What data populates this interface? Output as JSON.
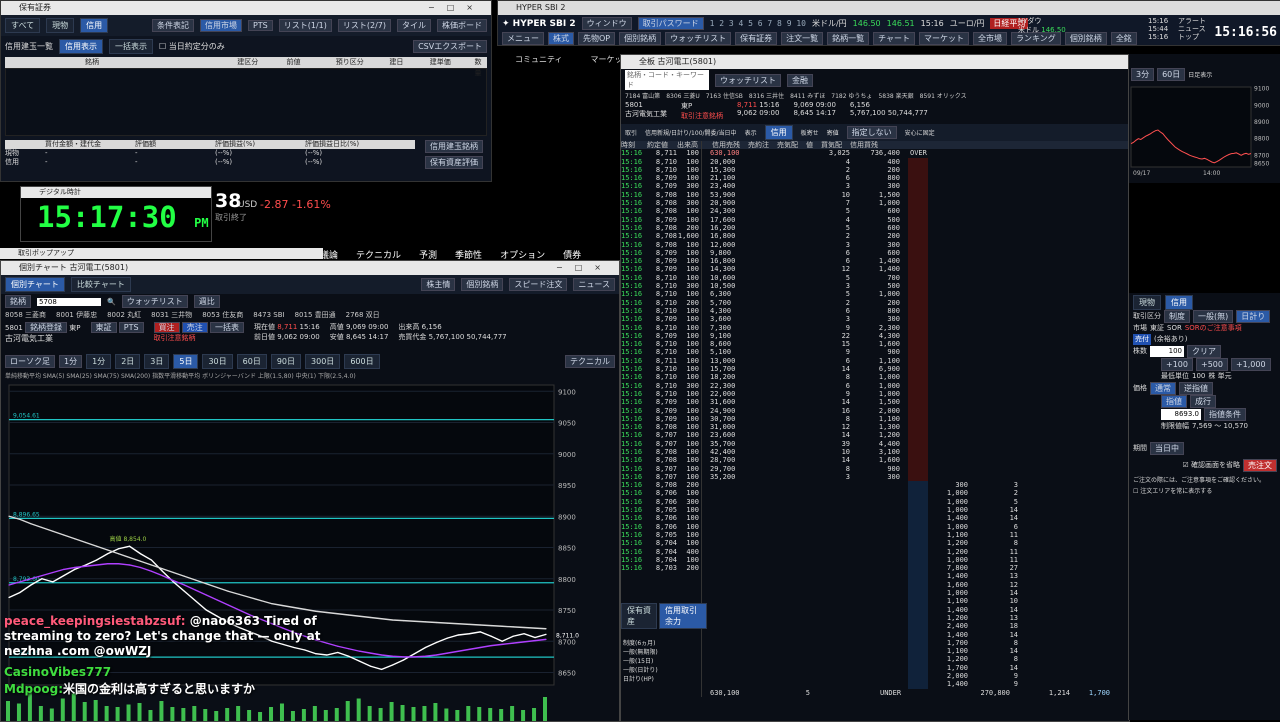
{
  "holdings_window": {
    "title": "保有証券",
    "tabs": [
      "すべて",
      "現物",
      "信用"
    ],
    "buttons": [
      "条件表記",
      "信用市場",
      "PTS",
      "リスト(1/1)",
      "リスト(2/7)",
      "タイル",
      "株価ボード"
    ],
    "subtabs": [
      "信用建玉一覧",
      "信用表示",
      "一括表示"
    ],
    "checkbox": "当日約定分のみ",
    "csv_button": "CSVエクスポート",
    "columns": [
      "銘柄",
      "建区分",
      "前値",
      "預り区分",
      "建日",
      "建単価",
      "数量"
    ],
    "summary_headers": [
      "買付金額・建代金",
      "評価額",
      "評価損益(%)",
      "評価損益日比(%)"
    ],
    "summary_rows": [
      {
        "label": "現物",
        "values": [
          "-",
          "-",
          "(--%)",
          "(--%)"
        ]
      },
      {
        "label": "信用",
        "values": [
          "-",
          "-",
          "(--%)",
          "(--%)"
        ]
      }
    ],
    "right_buttons": [
      "信用建玉銘柄",
      "保有資産評価"
    ]
  },
  "sbi_toolbar": {
    "title": "HYPER SBI 2",
    "menu": [
      "メニュー",
      "株式",
      "先物OP",
      "個別銘柄",
      "ウォッチリスト",
      "保有証券",
      "注文一覧",
      "銘柄一覧",
      "チャート",
      "マーケット",
      "全市場",
      "ランキング",
      "個別銘柄",
      "全銘"
    ],
    "window_label": "ウィンドウ",
    "order_password": "取引パスワード",
    "numbers": [
      "1",
      "2",
      "3",
      "4",
      "5",
      "6",
      "7",
      "8",
      "9",
      "10"
    ],
    "fx": [
      {
        "label": "米ドル/円",
        "value": "146.50",
        "change": "146.51"
      },
      {
        "label": "ユーロ/円",
        "value": ""
      }
    ],
    "time": "15:16",
    "indices": [
      {
        "name": "日経平均",
        "value": ""
      },
      {
        "name": "NYダウ",
        "value": ""
      },
      {
        "name": "米ドル",
        "value": "146.50"
      }
    ],
    "clock_small": [
      "15:16",
      "15:44",
      "15:16"
    ],
    "alerts": [
      "アラート",
      "ニュース",
      "トップ"
    ],
    "clock": "15:16:56"
  },
  "digital_clock": {
    "title": "デジタル時計",
    "time": "15:17:30",
    "ampm": "PM"
  },
  "background_ticker": {
    "value": "38",
    "currency": "USD",
    "change": "-2.87",
    "change_pct": "-1.61%",
    "sub": "取引終了"
  },
  "background_nav": [
    "議論",
    "テクニカル",
    "予測",
    "季節性",
    "オプション",
    "債券"
  ],
  "community_nav": [
    "コミュニティ",
    "マーケット"
  ],
  "popup_title": "取引ポップアップ",
  "chart_window": {
    "title": "個別チャート 古河電工(5801)",
    "tabs": [
      "個別チャート",
      "比較チャート"
    ],
    "right_tabs": [
      "株主情",
      "個別銘柄",
      "スピード注文",
      "ニュース"
    ],
    "search_label": "銘柄",
    "search_value": "5708",
    "dropdowns": [
      "ウォッチリスト",
      "週比"
    ],
    "stock_list": [
      "8058 三菱商",
      "8001 伊藤忠",
      "8002 丸紅",
      "8031 三井物",
      "8053 住友商",
      "8473 SBI",
      "8015 豊田通",
      "2768 双日"
    ],
    "code": "5801",
    "name": "古河電気工業",
    "market": "東P",
    "buttons": [
      "銘柄登録",
      "東証",
      "PTS",
      "買注",
      "売注",
      "一括表"
    ],
    "warn": "取引注意銘柄",
    "price_label": "現在値",
    "price": "8,711",
    "time": "15:16",
    "prev_label": "前日値",
    "prev": "9,062 09:00",
    "high_label": "高値",
    "high": "9,069 09:00",
    "low_label": "安値",
    "low": "8,645 14:17",
    "vol_label": "出来高",
    "volume": "6,156",
    "value_label": "売買代金",
    "value": "5,767,100",
    "other": "50,744,777",
    "chart_type": "ローソク足",
    "period": "1分",
    "period_buttons": [
      "1分",
      "2日",
      "3日",
      "5日",
      "30日",
      "60日",
      "90日",
      "300日",
      "600日"
    ],
    "legend": "単純移動平均 SMA(5) SMA(25) SMA(75) SMA(200) 指数平滑移動平均 ボリンジャーバンド 上限(1.5,80) 中央(1) 下限(2.5,4.0)",
    "tech_btn": "テクニカル"
  },
  "chart_data": {
    "type": "line",
    "title": "古河電気工業 5801 1分足",
    "xlabel": "",
    "ylabel": "",
    "x_ticks": [
      "09/17",
      "11:30",
      "13:00",
      "13:30",
      "14:00",
      "14:30",
      "15:00"
    ],
    "y_ticks": [
      "9100",
      "9050",
      "9000",
      "8950",
      "8900",
      "8850",
      "8800",
      "8750",
      "8700",
      "8650"
    ],
    "ylim": [
      8630,
      9110
    ],
    "hlines": [
      {
        "label": "9,054.61",
        "value": 9054.6
      },
      {
        "label": "8,896.65",
        "value": 8896.65
      },
      {
        "label": "8,793.60",
        "value": 8793.6
      },
      {
        "label": "8,674.65",
        "value": 8674.65
      }
    ],
    "annotation": "高値 8,854.0",
    "last_price_label": "8,711.0",
    "series": [
      {
        "name": "価格",
        "color": "#ffffff",
        "values": [
          8770,
          8778,
          8790,
          8800,
          8795,
          8805,
          8815,
          8822,
          8830,
          8840,
          8848,
          8852,
          8840,
          8830,
          8812,
          8795,
          8780,
          8765,
          8750,
          8740,
          8730,
          8722,
          8715,
          8708,
          8700,
          8695,
          8690,
          8686,
          8680,
          8678,
          8682,
          8676,
          8668,
          8660,
          8655,
          8662,
          8670,
          8680,
          8690,
          8698,
          8705,
          8710,
          8712,
          8715,
          8708,
          8700,
          8708,
          8712,
          8706,
          8711
        ]
      },
      {
        "name": "SMA200",
        "color": "#d9d9d9",
        "values": [
          8900,
          8895,
          8888,
          8882,
          8876,
          8870,
          8864,
          8858,
          8852,
          8846,
          8840,
          8834,
          8828,
          8822,
          8816,
          8810,
          8804,
          8798,
          8792,
          8786,
          8780,
          8775,
          8770,
          8765,
          8760,
          8757,
          8754,
          8751,
          8748,
          8746,
          8744,
          8742,
          8740,
          8738,
          8736,
          8734,
          8733,
          8732,
          8731,
          8730,
          8729,
          8728,
          8727,
          8726,
          8725,
          8724,
          8723,
          8722,
          8721,
          8720
        ]
      },
      {
        "name": "SMA75",
        "color": "#b040ff",
        "values": [
          8790,
          8795,
          8800,
          8805,
          8810,
          8815,
          8818,
          8820,
          8822,
          8824,
          8824,
          8822,
          8818,
          8812,
          8805,
          8797,
          8790,
          8782,
          8774,
          8766,
          8758,
          8750,
          8742,
          8735,
          8728,
          8721,
          8714,
          8708,
          8702,
          8697,
          8692,
          8688,
          8684,
          8681,
          8678,
          8676,
          8675,
          8675,
          8676,
          8678,
          8681,
          8684,
          8687,
          8690,
          8693,
          8695,
          8697,
          8699,
          8701,
          8703
        ]
      }
    ],
    "volume": [
      40,
      35,
      60,
      30,
      25,
      45,
      55,
      38,
      42,
      30,
      28,
      33,
      36,
      22,
      40,
      28,
      26,
      30,
      24,
      20,
      26,
      30,
      22,
      18,
      28,
      35,
      20,
      24,
      30,
      22,
      26,
      40,
      45,
      30,
      26,
      38,
      32,
      28,
      30,
      36,
      25,
      22,
      30,
      28,
      26,
      24,
      30,
      22,
      26,
      48
    ]
  },
  "board_window": {
    "title": "全板 古河電工(5801)",
    "search_label": "銘柄・コード・キーワード",
    "dropdowns": [
      "ウォッチリスト",
      "金融"
    ],
    "right_buttons": [
      "業界別",
      "同業種一覧",
      "チャート",
      "ニュース",
      "企業情報"
    ],
    "stock_list": [
      "7184 富山第",
      "8306 三菱U",
      "7163 住信SB",
      "8316 三井住",
      "8411 みずほ",
      "7182 ゆうちょ",
      "5838 楽天銀",
      "8591 オリックス",
      "8750 第一生",
      "7177 GMO",
      "8604 野村",
      "8354 ふくおか",
      "8253 クレセゾン"
    ],
    "code": "5801",
    "name": "古河電気工業",
    "market": "東P",
    "warn": "取引注意銘柄",
    "price": "8,711",
    "time": "15:16",
    "prev": "9,062 09:00",
    "open": "9,069 09:00",
    "high": "8,645 14:17",
    "volume": "6,156",
    "value": "5,767,100",
    "value2": "50,744,777",
    "toolbar": [
      "取引",
      "信用新規/日計り/100/開委/当日中",
      "表示",
      "信用",
      "板寄せ",
      "寄値",
      "指定しない",
      "安心に固定"
    ],
    "headers": [
      "時刻",
      "約定値",
      "出来高"
    ],
    "board_headers": [
      "信用売残",
      "売約注",
      "売気配",
      "ラ",
      "値",
      "買気配",
      "売約注",
      "買",
      "信用買残"
    ],
    "summary": {
      "over_label": "OVER",
      "over_qty": "736,400",
      "sell_total": "3,025",
      "under_label": "UNDER",
      "under_qty": "270,800",
      "buy_total": "1,214",
      "buy_extra": "1,700",
      "bottom_left": "630,100",
      "bottom_qty": "5"
    },
    "ticks": [
      [
        "15:16",
        "8,711",
        "100"
      ],
      [
        "15:16",
        "8,710",
        "100"
      ],
      [
        "15:16",
        "8,710",
        "100"
      ],
      [
        "15:16",
        "8,709",
        "100"
      ],
      [
        "15:16",
        "8,709",
        "300"
      ],
      [
        "15:16",
        "8,708",
        "100"
      ],
      [
        "15:16",
        "8,708",
        "300"
      ],
      [
        "15:16",
        "8,708",
        "100"
      ],
      [
        "15:16",
        "8,709",
        "100"
      ],
      [
        "15:16",
        "8,708",
        "200"
      ],
      [
        "15:16",
        "8,708",
        "1,600"
      ],
      [
        "15:16",
        "8,708",
        "100"
      ],
      [
        "15:16",
        "8,709",
        "100"
      ],
      [
        "15:16",
        "8,709",
        "100"
      ],
      [
        "15:16",
        "8,709",
        "100"
      ],
      [
        "15:16",
        "8,710",
        "100"
      ],
      [
        "15:16",
        "8,710",
        "300"
      ],
      [
        "15:16",
        "8,710",
        "100"
      ],
      [
        "15:16",
        "8,710",
        "200"
      ],
      [
        "15:16",
        "8,710",
        "100"
      ],
      [
        "15:16",
        "8,709",
        "100"
      ],
      [
        "15:16",
        "8,710",
        "100"
      ],
      [
        "15:16",
        "8,709",
        "100"
      ],
      [
        "15:16",
        "8,710",
        "100"
      ],
      [
        "15:16",
        "8,710",
        "100"
      ],
      [
        "15:16",
        "8,711",
        "100"
      ],
      [
        "15:16",
        "8,710",
        "100"
      ],
      [
        "15:16",
        "8,710",
        "100"
      ],
      [
        "15:16",
        "8,710",
        "300"
      ],
      [
        "15:16",
        "8,710",
        "100"
      ],
      [
        "15:16",
        "8,709",
        "100"
      ],
      [
        "15:16",
        "8,709",
        "100"
      ],
      [
        "15:16",
        "8,709",
        "100"
      ],
      [
        "15:16",
        "8,708",
        "100"
      ],
      [
        "15:16",
        "8,707",
        "100"
      ],
      [
        "15:16",
        "8,707",
        "100"
      ],
      [
        "15:16",
        "8,708",
        "100"
      ],
      [
        "15:16",
        "8,708",
        "100"
      ],
      [
        "15:16",
        "8,707",
        "100"
      ],
      [
        "15:16",
        "8,707",
        "100"
      ],
      [
        "15:16",
        "8,708",
        "200"
      ],
      [
        "15:16",
        "8,706",
        "100"
      ],
      [
        "15:16",
        "8,706",
        "300"
      ],
      [
        "15:16",
        "8,705",
        "100"
      ],
      [
        "15:16",
        "8,706",
        "100"
      ],
      [
        "15:16",
        "8,706",
        "100"
      ],
      [
        "15:16",
        "8,705",
        "100"
      ],
      [
        "15:16",
        "8,704",
        "100"
      ],
      [
        "15:16",
        "8,704",
        "400"
      ],
      [
        "15:16",
        "8,704",
        "100"
      ],
      [
        "15:16",
        "8,703",
        "200"
      ]
    ],
    "asks": [
      [
        "20,000",
        "4",
        "400"
      ],
      [
        "15,300",
        "2",
        "200"
      ],
      [
        "21,100",
        "6",
        "800"
      ],
      [
        "23,400",
        "3",
        "300"
      ],
      [
        "53,900",
        "10",
        "1,500"
      ],
      [
        "20,900",
        "7",
        "1,000"
      ],
      [
        "24,300",
        "5",
        "600"
      ],
      [
        "17,600",
        "4",
        "500"
      ],
      [
        "16,200",
        "5",
        "600"
      ],
      [
        "16,800",
        "2",
        "200"
      ],
      [
        "12,000",
        "3",
        "300"
      ],
      [
        "9,800",
        "6",
        "600"
      ],
      [
        "16,800",
        "6",
        "1,400"
      ],
      [
        "14,300",
        "12",
        "1,400"
      ],
      [
        "10,600",
        "5",
        "700"
      ],
      [
        "10,500",
        "3",
        "500"
      ],
      [
        "6,300",
        "5",
        "1,000"
      ],
      [
        "5,700",
        "2",
        "200"
      ],
      [
        "4,300",
        "6",
        "800"
      ],
      [
        "3,600",
        "3",
        "300"
      ],
      [
        "7,300",
        "9",
        "2,300"
      ],
      [
        "9,100",
        "22",
        "4,300"
      ],
      [
        "8,600",
        "15",
        "1,600"
      ],
      [
        "5,100",
        "9",
        "900"
      ],
      [
        "13,000",
        "6",
        "1,100"
      ],
      [
        "15,700",
        "14",
        "6,900"
      ],
      [
        "18,200",
        "8",
        "1,000"
      ],
      [
        "22,300",
        "6",
        "1,000"
      ],
      [
        "22,000",
        "9",
        "1,000"
      ],
      [
        "31,600",
        "14",
        "1,500"
      ],
      [
        "24,900",
        "16",
        "2,000"
      ],
      [
        "30,700",
        "8",
        "1,100"
      ],
      [
        "31,000",
        "12",
        "1,300"
      ],
      [
        "23,600",
        "14",
        "1,200"
      ],
      [
        "35,700",
        "39",
        "4,400"
      ],
      [
        "42,400",
        "10",
        "3,100"
      ],
      [
        "28,700",
        "14",
        "1,600"
      ],
      [
        "29,700",
        "8",
        "900"
      ],
      [
        "35,200",
        "3",
        "300"
      ]
    ],
    "bids": [
      [
        "300",
        "3"
      ],
      [
        "1,000",
        "2"
      ],
      [
        "1,000",
        "5"
      ],
      [
        "1,000",
        "14"
      ],
      [
        "1,400",
        "14"
      ],
      [
        "1,000",
        "6"
      ],
      [
        "1,100",
        "11"
      ],
      [
        "1,200",
        "8"
      ],
      [
        "1,200",
        "11"
      ],
      [
        "1,000",
        "11"
      ],
      [
        "7,800",
        "27"
      ],
      [
        "1,400",
        "13"
      ],
      [
        "1,600",
        "12"
      ],
      [
        "1,000",
        "14"
      ],
      [
        "1,100",
        "10"
      ],
      [
        "1,400",
        "14"
      ],
      [
        "1,200",
        "13"
      ],
      [
        "2,400",
        "18"
      ],
      [
        "1,400",
        "14"
      ],
      [
        "1,700",
        "8"
      ],
      [
        "1,100",
        "14"
      ],
      [
        "1,200",
        "8"
      ],
      [
        "1,700",
        "14"
      ],
      [
        "2,000",
        "9"
      ],
      [
        "1,400",
        "9"
      ]
    ],
    "bottom_tabs": [
      "保有資産",
      "信用取引余力"
    ],
    "position_rows": [
      "制度(6ヵ月)",
      "一般(無期限)",
      "一般(15日)",
      "一般(日計り)",
      "日計り(HP)"
    ]
  },
  "mini_chart": {
    "period": "3分",
    "range": "60日",
    "checkbox": "日足表示",
    "y_ticks": [
      "9100",
      "9000",
      "8900",
      "8800",
      "8700",
      "8650"
    ],
    "x_ticks": [
      "09/17",
      "14:00"
    ]
  },
  "order_panel": {
    "tabs": [
      "現物",
      "信用"
    ],
    "labels": {
      "type": "取引区分",
      "kind": "市場",
      "qty": "株数",
      "price": "価格",
      "period": "期間"
    },
    "trade_types": [
      "制度",
      "一般(無)",
      "日計り"
    ],
    "market": "東証",
    "sor": "SOR",
    "sor_link": "SORのご注意事項",
    "side": "売付",
    "side_btn": "(余裕あり)",
    "qty": "100",
    "qty_clear": "クリア",
    "qty_steps": [
      "+100",
      "+500",
      "+1,000"
    ],
    "unit": "最低単位",
    "unit_val": "100",
    "unit_suffix": "株 単元",
    "price_type": [
      "通常",
      "逆指値"
    ],
    "cond": [
      "指値",
      "成行"
    ],
    "price": "8693.0",
    "price_opt": "指値条件",
    "limit_label": "制限値幅",
    "limit": "7,569 ～ 10,570",
    "period_val": "当日中",
    "confirm": "確認画面を省略",
    "submit": "売注文",
    "note": "ご注文の際には、ご注意事項をご確認ください。",
    "note2": "注文エリアを常に表示する"
  },
  "stream_chat": [
    {
      "user": "peace_keepingsiestabzsuf:",
      "text": "@nao6363 Tired of streaming to zero? Let's change that — only at nezhna .com @owWZJ"
    },
    {
      "user": "CasinoVibes777",
      "text": ""
    },
    {
      "user": "Mdpoog:",
      "text": "米国の金利は高すぎると思いますか"
    }
  ]
}
